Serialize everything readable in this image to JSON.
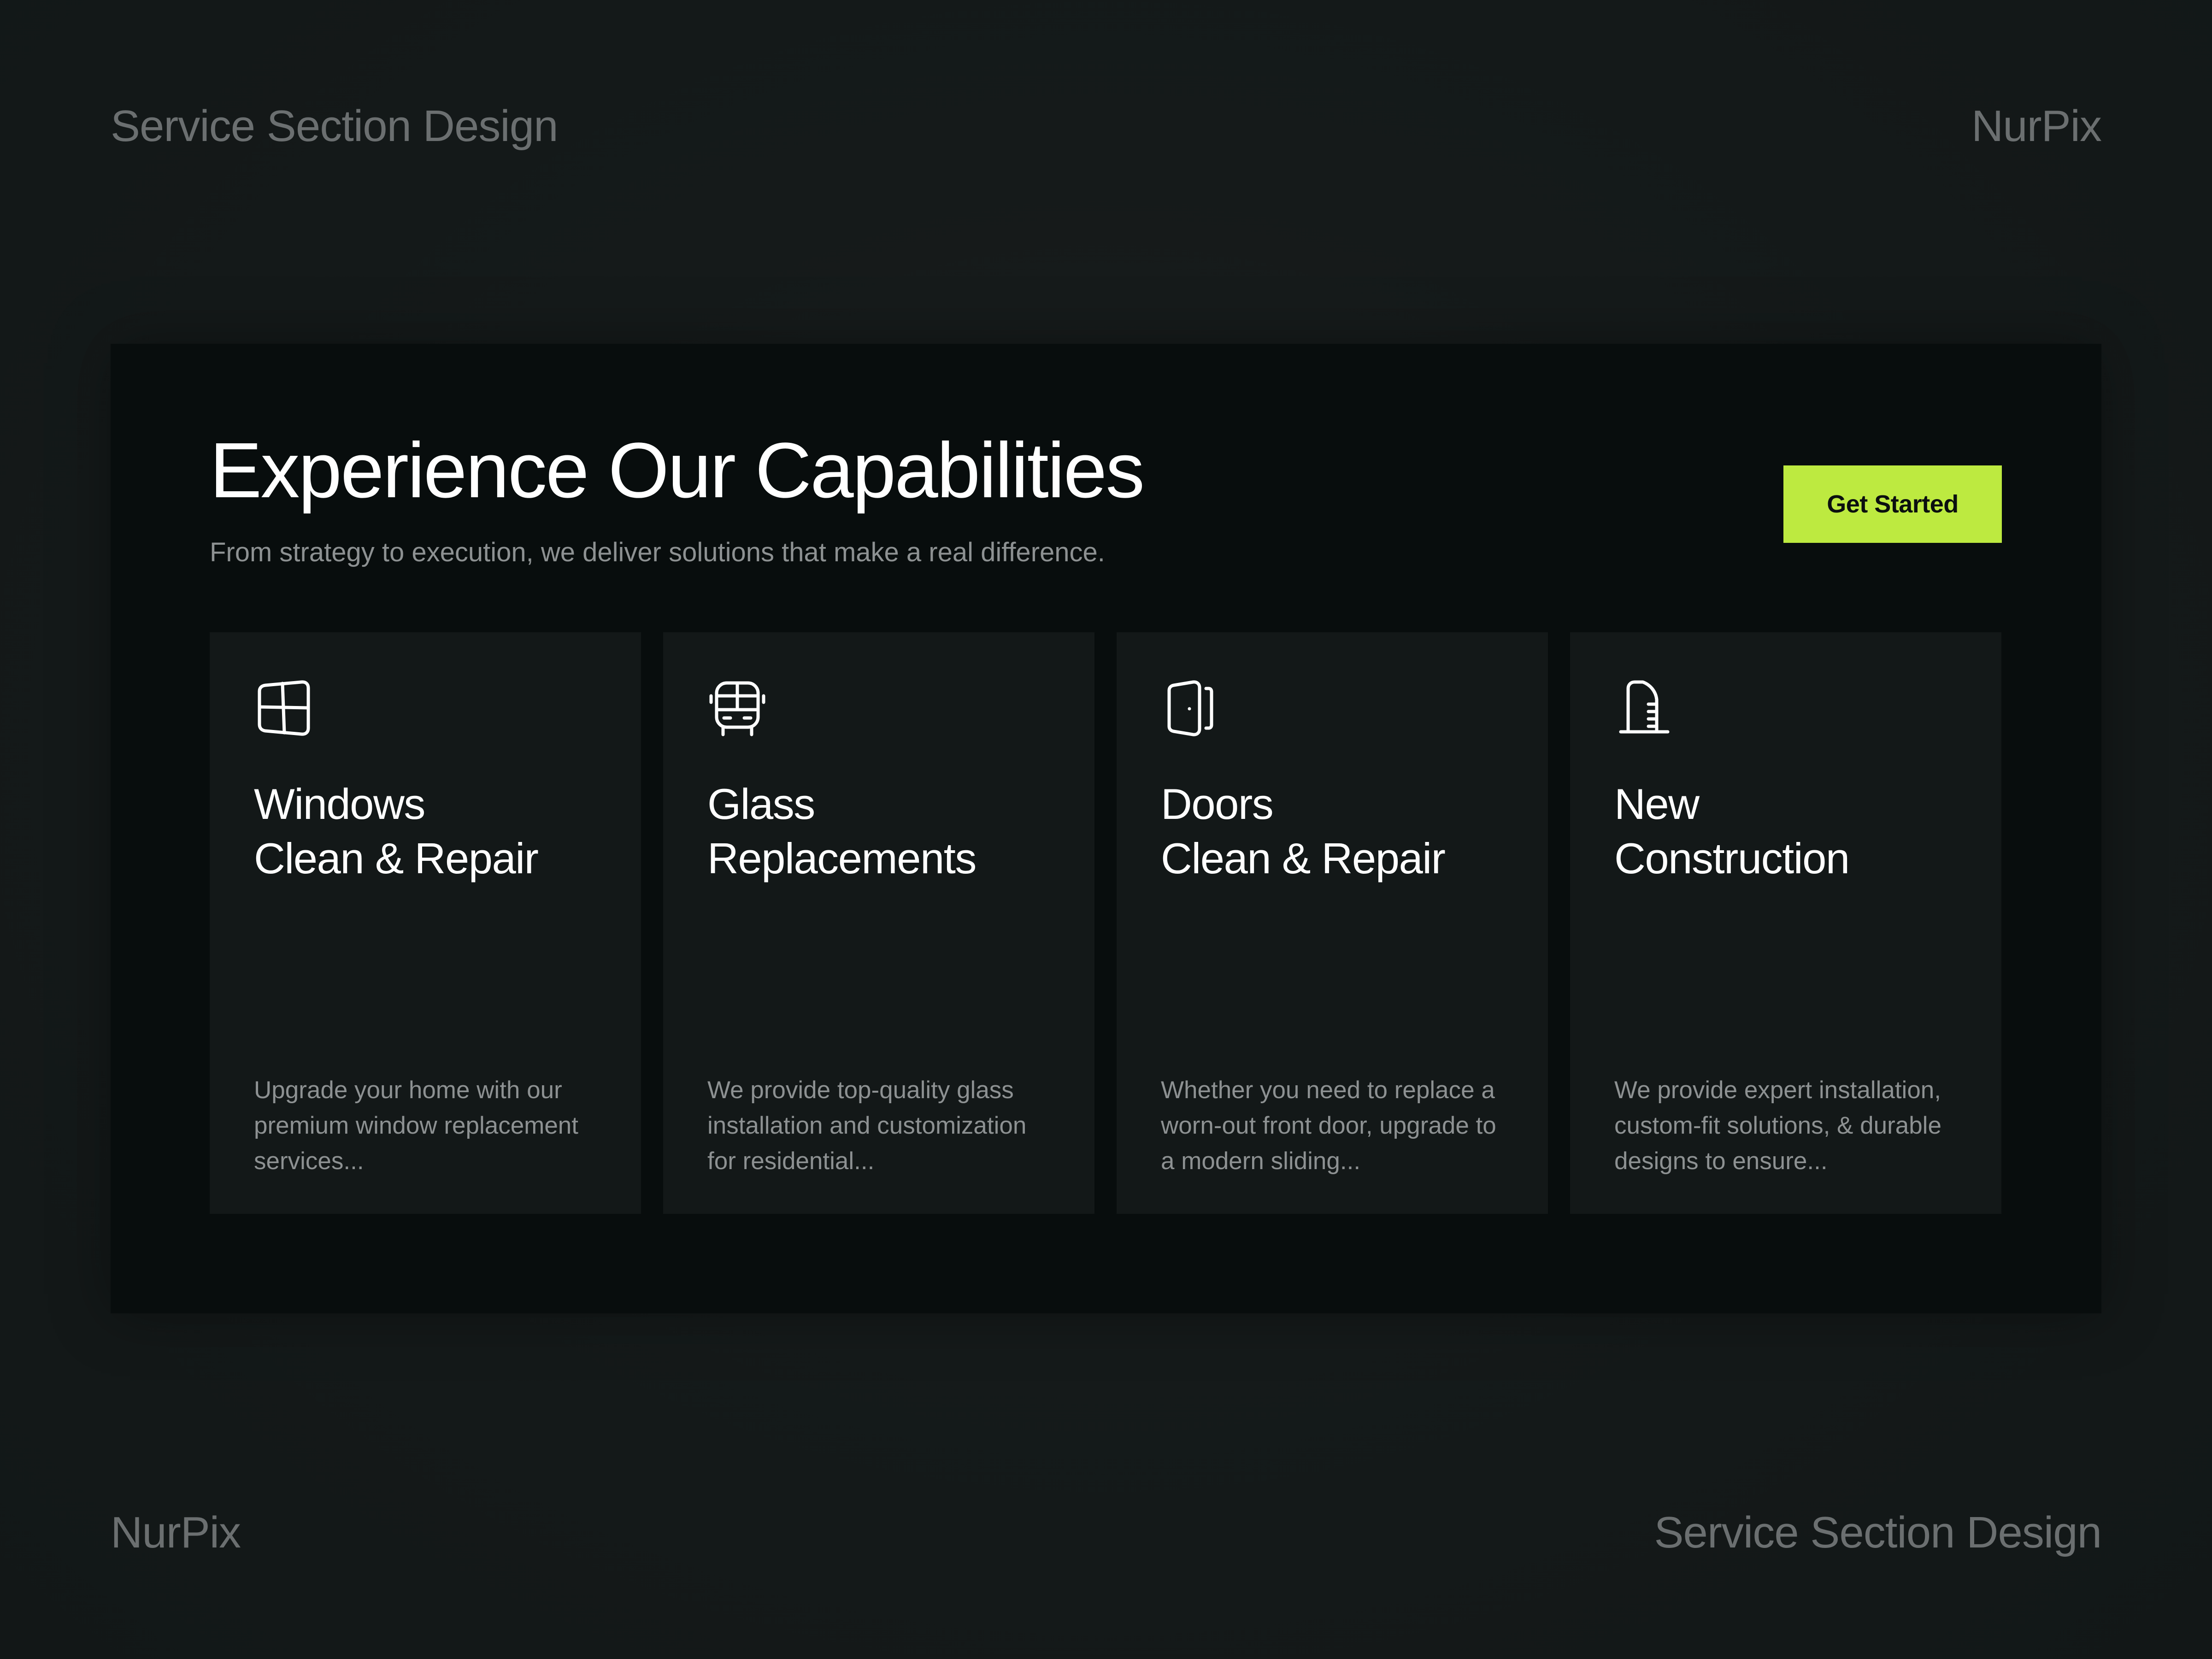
{
  "corners": {
    "top_left": "Service Section Design",
    "top_right": "NurPix",
    "bottom_left": "NurPix",
    "bottom_right": "Service Section Design"
  },
  "section": {
    "headline": "Experience Our Capabilities",
    "subtitle": "From strategy to execution, we deliver solutions that make a real difference.",
    "cta_label": "Get Started"
  },
  "cards": [
    {
      "icon": "window-icon",
      "title_lines": [
        "Windows",
        "Clean & Repair"
      ],
      "desc_lines": [
        "Upgrade your home with our",
        "premium window replacement",
        "services..."
      ]
    },
    {
      "icon": "glass-pane-icon",
      "title_lines": [
        "Glass",
        "Replacements"
      ],
      "desc_lines": [
        "We provide top-quality glass",
        "installation and customization",
        "for residential..."
      ]
    },
    {
      "icon": "door-icon",
      "title_lines": [
        "Doors",
        "Clean & Repair"
      ],
      "desc_lines": [
        "Whether you need to replace a",
        "worn-out front door, upgrade to",
        "a modern sliding..."
      ]
    },
    {
      "icon": "building-icon",
      "title_lines": [
        "New",
        "Construction"
      ],
      "desc_lines": [
        "We provide expert installation,",
        "custom-fit solutions, & durable",
        "designs to ensure..."
      ]
    }
  ],
  "colors": {
    "accent": "#bdea40",
    "panel_background": "#080d0d",
    "card_background": "#131818",
    "page_background": "#151a1a",
    "muted_text": "#8d9192",
    "corner_text": "#6b6f70"
  }
}
